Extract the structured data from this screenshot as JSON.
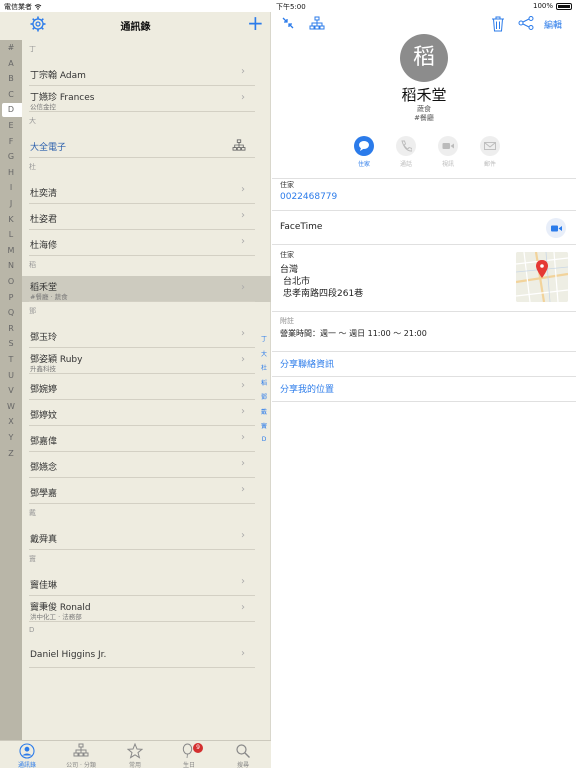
{
  "status": {
    "carrier": "電信業者",
    "time": "下午5:00",
    "battery": "100%"
  },
  "left": {
    "title": "通訊錄",
    "index_letters": [
      "#",
      "A",
      "B",
      "C",
      "D",
      "E",
      "F",
      "G",
      "H",
      "I",
      "J",
      "K",
      "L",
      "M",
      "N",
      "O",
      "P",
      "Q",
      "R",
      "S",
      "T",
      "U",
      "V",
      "W",
      "X",
      "Y",
      "Z"
    ],
    "active_letter": "D",
    "sections": [
      {
        "header": "丁",
        "rows": [
          {
            "name": "丁宗翰 Adam",
            "sub": ""
          },
          {
            "name": "丁嬿珍 Frances",
            "sub": "公信金控"
          }
        ]
      },
      {
        "header": "大",
        "rows": [
          {
            "name": "大全電子",
            "sub": "",
            "company": true
          }
        ]
      },
      {
        "header": "杜",
        "rows": [
          {
            "name": "杜奕清",
            "sub": ""
          },
          {
            "name": "杜姿君",
            "sub": ""
          },
          {
            "name": "杜海修",
            "sub": ""
          }
        ]
      },
      {
        "header": "稻",
        "rows": [
          {
            "name": "稻禾堂",
            "sub": "#餐廳 · 蔬食",
            "selected": true
          }
        ]
      },
      {
        "header": "鄧",
        "rows": [
          {
            "name": "鄧玉玲",
            "sub": ""
          },
          {
            "name": "鄧姿穎 Ruby",
            "sub": "升鑫科技"
          },
          {
            "name": "鄧婉婷",
            "sub": ""
          },
          {
            "name": "鄧婷妏",
            "sub": ""
          },
          {
            "name": "鄧嘉偉",
            "sub": ""
          },
          {
            "name": "鄧嬿念",
            "sub": ""
          },
          {
            "name": "鄧學嘉",
            "sub": ""
          }
        ]
      },
      {
        "header": "戴",
        "rows": [
          {
            "name": "戴舜真",
            "sub": ""
          }
        ]
      },
      {
        "header": "竇",
        "rows": [
          {
            "name": "竇佳琳",
            "sub": ""
          },
          {
            "name": "竇秉俊 Ronald",
            "sub": "洪中化工 · 法務部"
          }
        ]
      },
      {
        "header": "D",
        "rows": [
          {
            "name": "Daniel Higgins Jr.",
            "sub": ""
          }
        ]
      }
    ],
    "side_index": [
      "丁",
      "大",
      "杜",
      "稻",
      "鄧",
      "戴",
      "竇",
      "D"
    ],
    "tabs": [
      {
        "label": "通訊錄",
        "icon": "person-icon",
        "active": true
      },
      {
        "label": "公司 · 分類",
        "icon": "org-chart-icon"
      },
      {
        "label": "常用",
        "icon": "star-icon"
      },
      {
        "label": "生日",
        "icon": "balloon-icon",
        "badge": "9"
      },
      {
        "label": "搜尋",
        "icon": "search-icon"
      }
    ]
  },
  "right": {
    "edit_label": "編輯",
    "avatar_char": "稻",
    "name": "稻禾堂",
    "line1": "蔬食",
    "line2": "#餐廳",
    "actions": [
      {
        "label": "住家",
        "icon": "message-icon",
        "primary": true
      },
      {
        "label": "通話",
        "icon": "phone-icon"
      },
      {
        "label": "視訊",
        "icon": "video-icon"
      },
      {
        "label": "郵件",
        "icon": "mail-icon"
      }
    ],
    "phone_label": "住家",
    "phone_value": "0022468779",
    "facetime_label": "FaceTime",
    "address_label": "住家",
    "address_lines": [
      "台灣",
      "台北市",
      "忠孝南路四段261巷"
    ],
    "notes_label": "附註",
    "notes_value": "營業時間：週一 ～ 週日 11:00 ～ 21:00",
    "share_contact": "分享聯絡資訊",
    "share_location": "分享我的位置"
  },
  "colors": {
    "accent": "#2b7bea",
    "left_bg": "#eeece0",
    "index_bg": "#b9b6a8",
    "badge": "#d32f2f"
  }
}
